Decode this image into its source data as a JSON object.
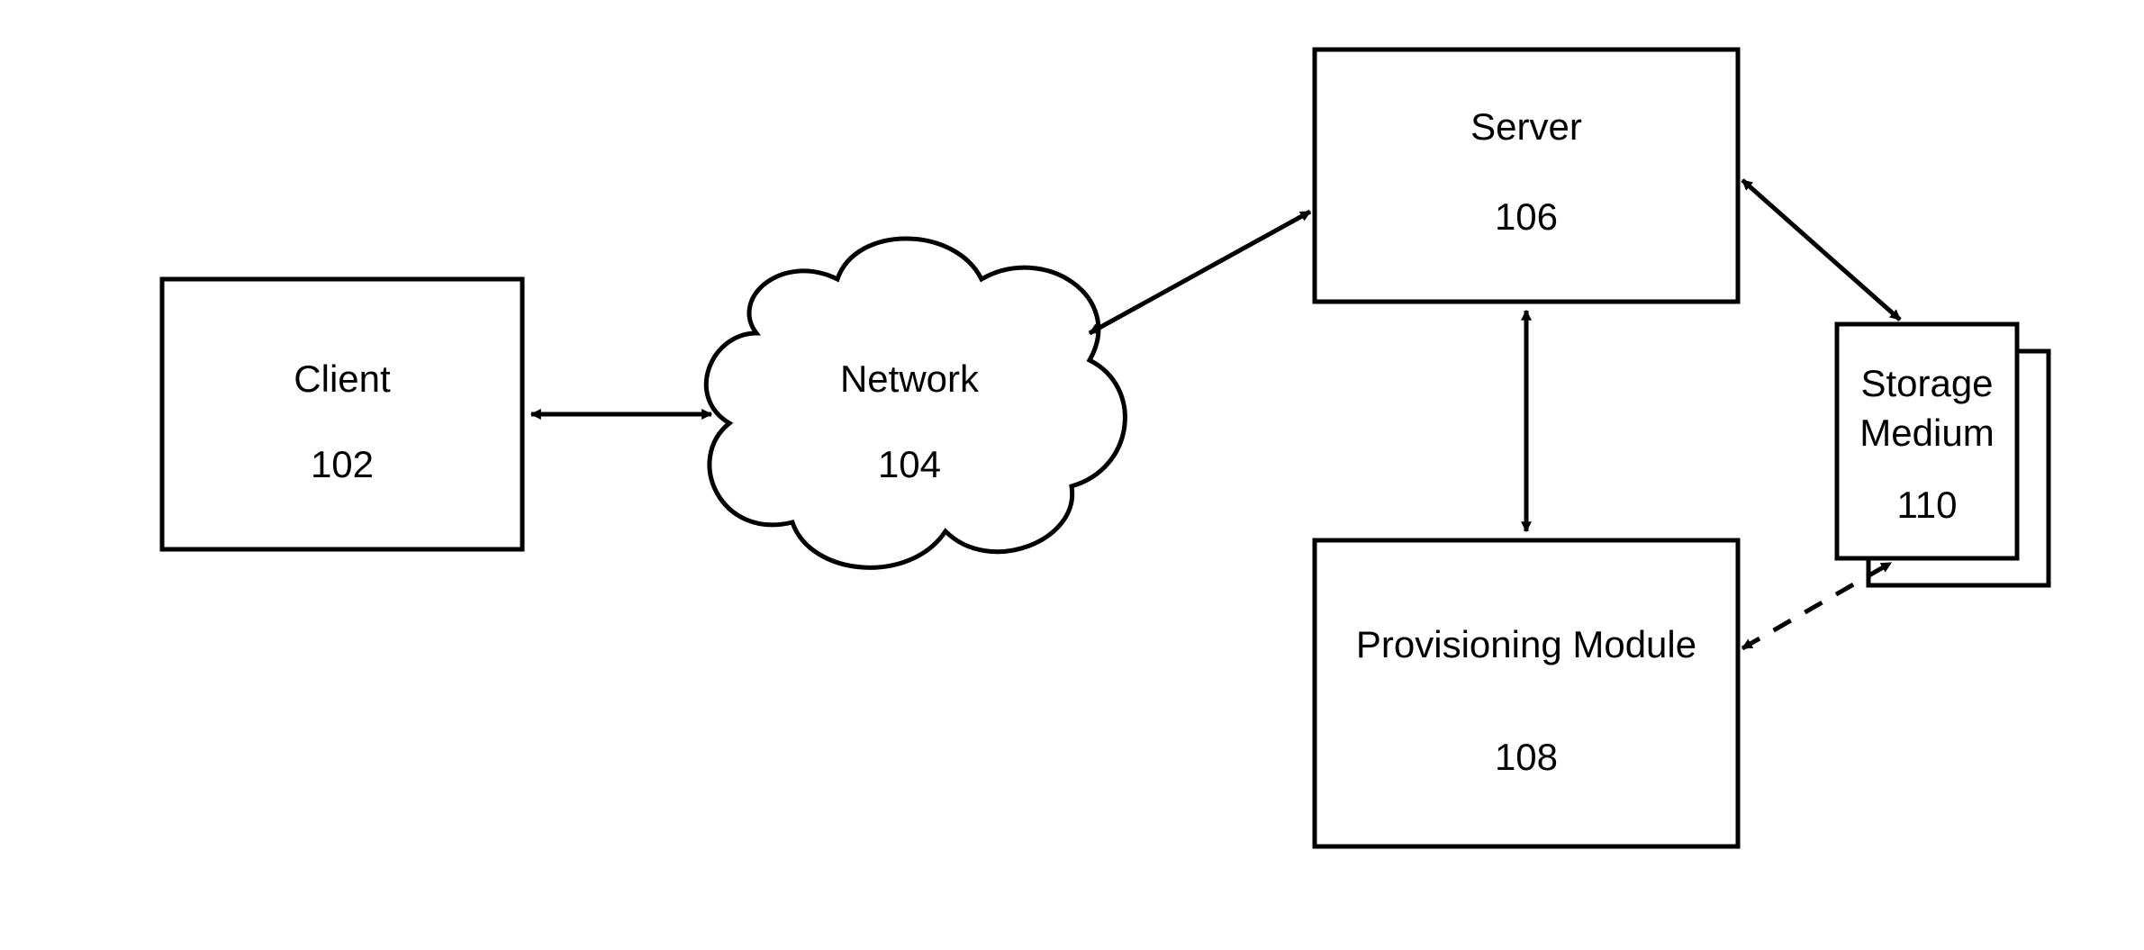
{
  "nodes": {
    "client": {
      "label": "Client",
      "ref": "102"
    },
    "network": {
      "label": "Network",
      "ref": "104"
    },
    "server": {
      "label": "Server",
      "ref": "106"
    },
    "prov": {
      "label": "Provisioning Module",
      "ref": "108"
    },
    "storage": {
      "label1": "Storage",
      "label2": "Medium",
      "ref": "110"
    }
  },
  "edges": [
    {
      "from": "client",
      "to": "network",
      "style": "solid",
      "bidir": true
    },
    {
      "from": "network",
      "to": "server",
      "style": "solid",
      "bidir": true
    },
    {
      "from": "server",
      "to": "prov",
      "style": "solid",
      "bidir": true
    },
    {
      "from": "server",
      "to": "storage",
      "style": "solid",
      "bidir": true
    },
    {
      "from": "prov",
      "to": "storage",
      "style": "dashed",
      "bidir": true
    }
  ]
}
